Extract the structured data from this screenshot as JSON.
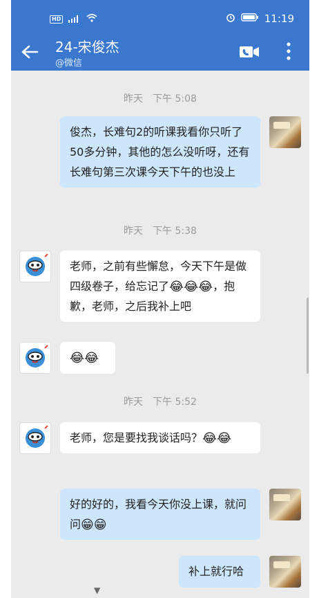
{
  "status_bar": {
    "hd_badge": "HD",
    "network": "⁴ᴳ",
    "time": "11:19"
  },
  "header": {
    "title": "24-宋俊杰",
    "subtitle": "@微信"
  },
  "messages": {
    "ts1": "昨天　下午 5:08",
    "m1": "俊杰，长难句2的听课我看你只听了50多分钟，其他的怎么没听呀，还有长难句第三次课今天下午的也没上",
    "ts2": "昨天　下午 5:38",
    "m2_text1": "老师，之前有些懈怠，今天下午是做四级卷子，给忘记了",
    "m2_text2": "，抱歉，老师，之后我补上吧",
    "ts3": "昨天　下午 5:52",
    "m4_text": "老师，您是要找我谈话吗？",
    "m5_text": "好的好的，我看今天你没上课，就问问",
    "m6_text": "补上就行哈"
  },
  "icons": {
    "laugh_cry": "😂",
    "grin": "😁"
  },
  "colors": {
    "header_bg": "#3a78cf",
    "bubble_me": "#cde6fb",
    "bubble_them": "#ffffff",
    "chat_bg": "#ebebeb"
  }
}
